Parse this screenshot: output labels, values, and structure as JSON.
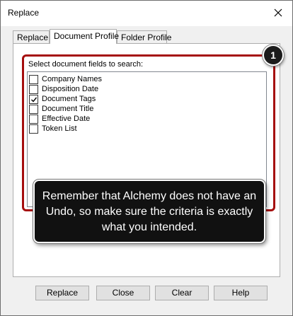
{
  "window": {
    "title": "Replace"
  },
  "tabs": [
    {
      "label": "Replace",
      "active": false
    },
    {
      "label": "Document Profile",
      "active": true
    },
    {
      "label": "Folder Profile",
      "active": false
    }
  ],
  "panel": {
    "label": "Select document fields to search:",
    "fields": [
      {
        "label": "Company Names",
        "checked": false
      },
      {
        "label": "Disposition Date",
        "checked": false
      },
      {
        "label": "Document Tags",
        "checked": true
      },
      {
        "label": "Document Title",
        "checked": false
      },
      {
        "label": "Effective Date",
        "checked": false
      },
      {
        "label": "Token List",
        "checked": false
      }
    ]
  },
  "annotation": {
    "step": "1",
    "callout_text": "Remember that Alchemy does not have an Undo, so make sure the criteria is exactly what you intended.",
    "highlight_color": "#a50d0d"
  },
  "buttons": {
    "replace": "Replace",
    "close": "Close",
    "clear": "Clear",
    "help": "Help"
  }
}
